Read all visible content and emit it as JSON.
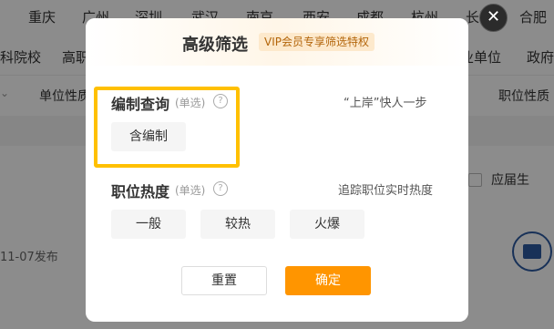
{
  "background": {
    "cities": [
      "重庆",
      "广州",
      "深圳",
      "武汉",
      "南京",
      "西安",
      "成都",
      "杭州",
      "长沙",
      "合肥"
    ],
    "types": [
      "科院校",
      "高职",
      "业单位",
      "政府"
    ],
    "filters": {
      "left": "单位性质",
      "right": "职位性质"
    },
    "publish_date": "11-07发布",
    "fresh_grad_label": "应届生"
  },
  "modal": {
    "title": "高级筛选",
    "vip_badge": "VIP会员专享筛选特权",
    "establishment": {
      "title": "编制查询",
      "mode": "(单选)",
      "hint": "“上岸”快人一步",
      "options": [
        "含编制"
      ]
    },
    "heat": {
      "title": "职位热度",
      "mode": "(单选)",
      "hint": "追踪职位实时热度",
      "options": [
        "一般",
        "较热",
        "火爆"
      ]
    },
    "reset_label": "重置",
    "confirm_label": "确定"
  },
  "colors": {
    "accent": "#ff9500",
    "highlight": "#ffc000"
  },
  "icons": {
    "close": "close-icon",
    "help": "question-circle-icon"
  }
}
